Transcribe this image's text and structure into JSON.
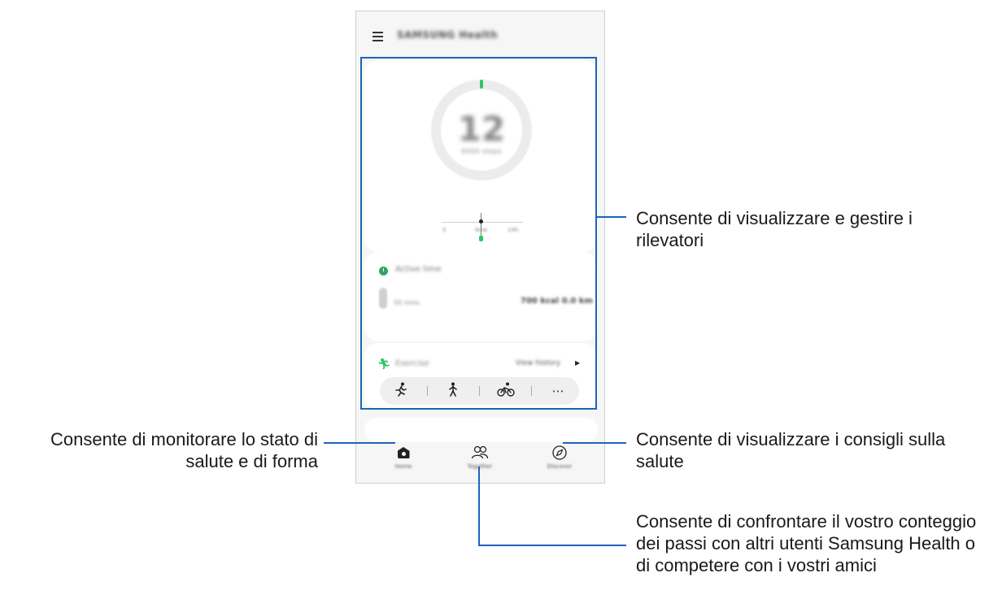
{
  "app": {
    "title": "SAMSUNG Health"
  },
  "steps_card": {
    "count": "12",
    "subtitle": "6000 steps",
    "ticks": [
      "0",
      "Now",
      "24h"
    ]
  },
  "active_time_card": {
    "title": "Active time",
    "minutes_label": "50 mins",
    "kcal": "700 kcal 0.0 km"
  },
  "exercise_card": {
    "title": "Exercise",
    "link": "View history",
    "quick_icons": [
      "running-icon",
      "walking-icon",
      "cycling-icon",
      "more-icon"
    ]
  },
  "bottom_nav": {
    "home_label": "Home",
    "together_label": "Together",
    "discover_label": "Discover"
  },
  "callouts": {
    "trackers": "Consente di visualizzare e gestire i rilevatori",
    "home": "Consente di monitorare lo stato di salute e di forma",
    "discover": "Consente di visualizzare i consigli sulla salute",
    "together": "Consente di confrontare il vostro conteggio dei passi con altri utenti Samsung Health o di competere con i vostri amici"
  },
  "colors": {
    "callout_line": "#1d63b8",
    "accent_green": "#2ec466"
  }
}
